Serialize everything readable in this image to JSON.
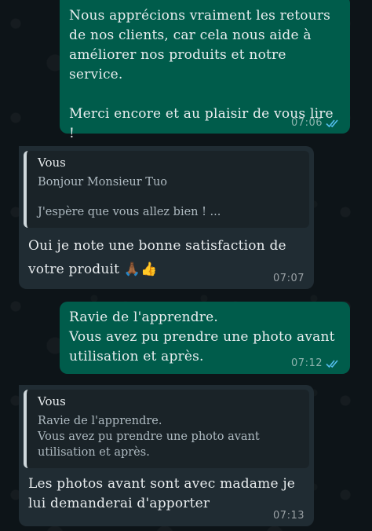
{
  "messages": [
    {
      "direction": "outgoing",
      "text": "Nous apprécions vraiment les retours\nde nos clients, car cela nous aide à\naméliorer nos produits et notre service.\n\nMerci encore et au plaisir de vous lire !",
      "time": "07:06",
      "status": "read"
    },
    {
      "direction": "incoming",
      "quote": {
        "author": "Vous",
        "line1": "Bonjour Monsieur Tuo",
        "line2": "J'espère que vous allez bien ! ..."
      },
      "text": "Oui je note une bonne satisfaction de\nvotre produit 🙏🏾👍",
      "time": "07:07"
    },
    {
      "direction": "outgoing",
      "text": "Ravie de l'apprendre.\nVous avez pu prendre une photo avant\nutilisation et après.",
      "time": "07:12",
      "status": "read"
    },
    {
      "direction": "incoming",
      "quote": {
        "author": "Vous",
        "text": "Ravie de l'apprendre.\nVous avez pu prendre une photo avant\nutilisation et après."
      },
      "text": "Les photos avant sont avec madame je\nlui demanderai d'apporter",
      "time": "07:13"
    }
  ],
  "colors": {
    "outgoing_bubble": "#005c4b",
    "incoming_bubble": "#202c33",
    "read_ticks": "#53bdeb",
    "background": "#0b141a"
  }
}
